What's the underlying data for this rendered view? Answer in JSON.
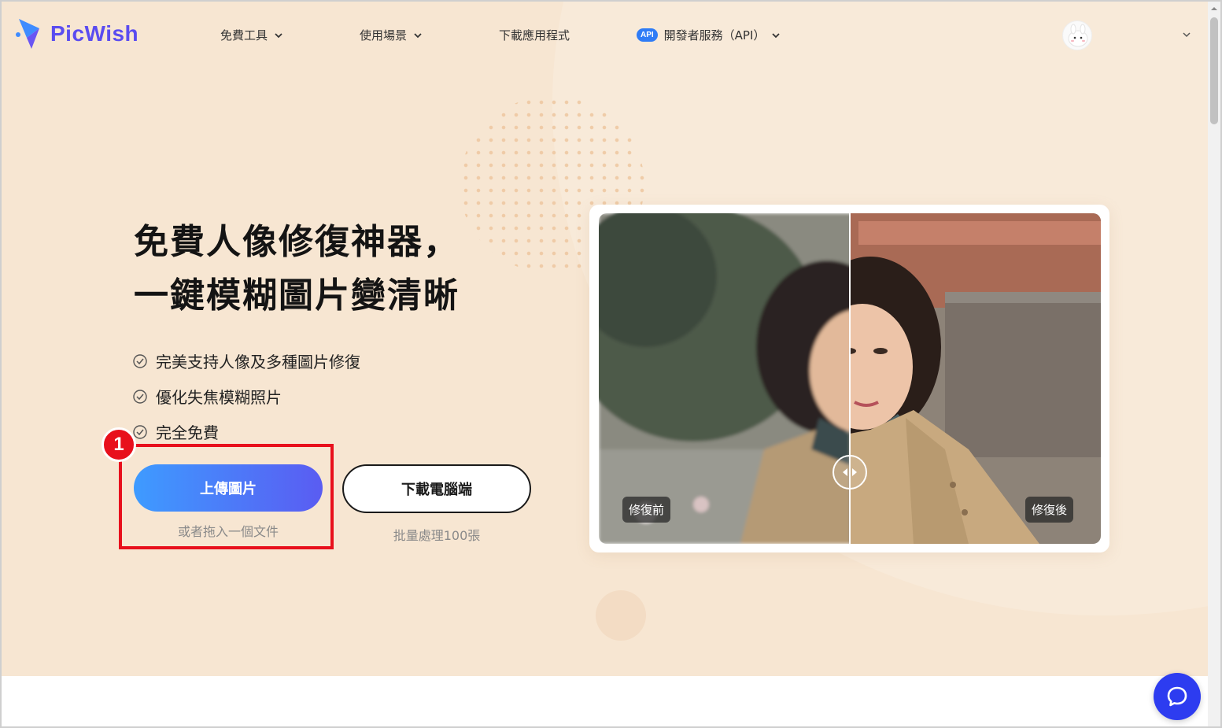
{
  "brand": {
    "name": "PicWish",
    "color": "#5a4cf0"
  },
  "nav": {
    "items": [
      {
        "label": "免費工具",
        "has_dropdown": true
      },
      {
        "label": "使用場景",
        "has_dropdown": true
      },
      {
        "label": "下載應用程式",
        "has_dropdown": false
      },
      {
        "label": "開發者服務（API）",
        "badge": "API",
        "has_dropdown": true
      }
    ]
  },
  "hero": {
    "headline_line1": "免費人像修復神器，",
    "headline_line2": "一鍵模糊圖片變清晰",
    "features": [
      "完美支持人像及多種圖片修復",
      "優化失焦模糊照片",
      "完全免費"
    ],
    "upload_button": "上傳圖片",
    "upload_sub": "或者拖入一個文件",
    "desktop_button": "下載電腦端",
    "desktop_sub": "批量處理100張",
    "step_number": "1",
    "accent_gradient": [
      "#3e9bff",
      "#5a5cf2"
    ],
    "highlight_color": "#e8101c"
  },
  "compare": {
    "before_label": "修復前",
    "after_label": "修復後"
  },
  "colors": {
    "hero_bg": "#f7e6d2",
    "chat": "#2d3cf0"
  }
}
